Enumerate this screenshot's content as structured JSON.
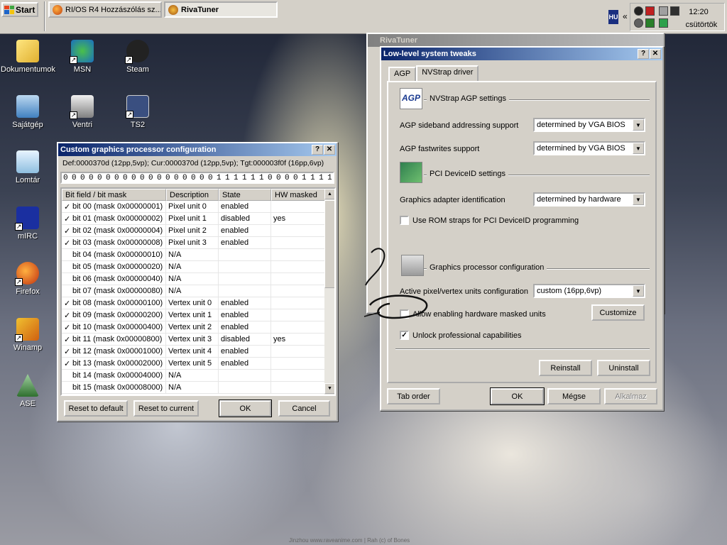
{
  "taskbar": {
    "start_label": "Start",
    "tasks": [
      {
        "label": "RI/OS R4 Hozzászólás sz..."
      },
      {
        "label": "RivaTuner"
      }
    ],
    "lang": "HU",
    "clock_time": "12:20",
    "clock_day": "csütörtök"
  },
  "desktop_icons": [
    {
      "label": "Dokumentumok"
    },
    {
      "label": "MSN"
    },
    {
      "label": "Steam"
    },
    {
      "label": "Sajátgép"
    },
    {
      "label": "Ventri"
    },
    {
      "label": "TS2"
    },
    {
      "label": "Lomtár"
    },
    {
      "label": "mIRC"
    },
    {
      "label": "Firefox"
    },
    {
      "label": "Winamp"
    },
    {
      "label": "ASE"
    }
  ],
  "custom_dialog": {
    "title": "Custom graphics processor configuration",
    "info": "Def:0000370d (12pp,5vp); Cur:0000370d (12pp,5vp); Tgt:000003f0f (16pp,6vp)",
    "bits": "0 0 0 0 0 0 0 0 0 0 0 0 0 0 0 0 0 0 1 1 1 1 1 1 0 0 0 0 1 1 1 1",
    "columns": [
      "Bit field / bit mask",
      "Description",
      "State",
      "HW masked"
    ],
    "rows": [
      {
        "check": "✓",
        "field": "bit 00 (mask 0x00000001)",
        "desc": "Pixel unit 0",
        "state": "enabled",
        "hw": ""
      },
      {
        "check": "✓",
        "field": "bit 01 (mask 0x00000002)",
        "desc": "Pixel unit 1",
        "state": "disabled",
        "hw": "yes"
      },
      {
        "check": "✓",
        "field": "bit 02 (mask 0x00000004)",
        "desc": "Pixel unit 2",
        "state": "enabled",
        "hw": ""
      },
      {
        "check": "✓",
        "field": "bit 03 (mask 0x00000008)",
        "desc": "Pixel unit 3",
        "state": "enabled",
        "hw": ""
      },
      {
        "check": "",
        "field": "bit 04 (mask 0x00000010)",
        "desc": "N/A",
        "state": "",
        "hw": ""
      },
      {
        "check": "",
        "field": "bit 05 (mask 0x00000020)",
        "desc": "N/A",
        "state": "",
        "hw": ""
      },
      {
        "check": "",
        "field": "bit 06 (mask 0x00000040)",
        "desc": "N/A",
        "state": "",
        "hw": ""
      },
      {
        "check": "",
        "field": "bit 07 (mask 0x00000080)",
        "desc": "N/A",
        "state": "",
        "hw": ""
      },
      {
        "check": "✓",
        "field": "bit 08 (mask 0x00000100)",
        "desc": "Vertex unit 0",
        "state": "enabled",
        "hw": ""
      },
      {
        "check": "✓",
        "field": "bit 09 (mask 0x00000200)",
        "desc": "Vertex unit 1",
        "state": "enabled",
        "hw": ""
      },
      {
        "check": "✓",
        "field": "bit 10 (mask 0x00000400)",
        "desc": "Vertex unit 2",
        "state": "enabled",
        "hw": ""
      },
      {
        "check": "✓",
        "field": "bit 11 (mask 0x00000800)",
        "desc": "Vertex unit 3",
        "state": "disabled",
        "hw": "yes"
      },
      {
        "check": "✓",
        "field": "bit 12 (mask 0x00001000)",
        "desc": "Vertex unit 4",
        "state": "enabled",
        "hw": ""
      },
      {
        "check": "✓",
        "field": "bit 13 (mask 0x00002000)",
        "desc": "Vertex unit 5",
        "state": "enabled",
        "hw": ""
      },
      {
        "check": "",
        "field": "bit 14 (mask 0x00004000)",
        "desc": "N/A",
        "state": "",
        "hw": ""
      },
      {
        "check": "",
        "field": "bit 15 (mask 0x00008000)",
        "desc": "N/A",
        "state": "",
        "hw": ""
      }
    ],
    "buttons": {
      "reset_default": "Reset to default",
      "reset_current": "Reset to current",
      "ok": "OK",
      "cancel": "Cancel"
    }
  },
  "rivatuner_window": {
    "title": "RivaTuner"
  },
  "tweaks_dialog": {
    "title": "Low-level system tweaks",
    "tabs": [
      "AGP",
      "NVStrap driver"
    ],
    "agp_group": "NVStrap AGP settings",
    "sideband_label": "AGP sideband addressing support",
    "sideband_value": "determined by VGA BIOS",
    "fastwrites_label": "AGP fastwrites support",
    "fastwrites_value": "determined by VGA BIOS",
    "pci_group": "PCI DeviceID settings",
    "adapter_label": "Graphics adapter identification",
    "adapter_value": "determined by hardware",
    "rom_straps_label": "Use ROM straps for PCI DeviceID programming",
    "gpu_group": "Graphics processor configuration",
    "active_units_label": "Active pixel/vertex units configuration",
    "active_units_value": "custom (16pp,6vp)",
    "allow_masked_label": "Allow enabling hardware masked units",
    "customize": "Customize",
    "unlock_label": "Unlock professional capabilities",
    "reinstall": "Reinstall",
    "uninstall": "Uninstall",
    "tab_order": "Tab order",
    "ok": "OK",
    "cancel": "Mégse",
    "apply": "Alkalmaz"
  },
  "wallpaper_footer": "Jinzhou www.raveanime.com | Rah (c) of Bones",
  "colors": {
    "active_title_start": "#0a246a",
    "active_title_end": "#a6caf0",
    "face": "#d4d0c8"
  }
}
